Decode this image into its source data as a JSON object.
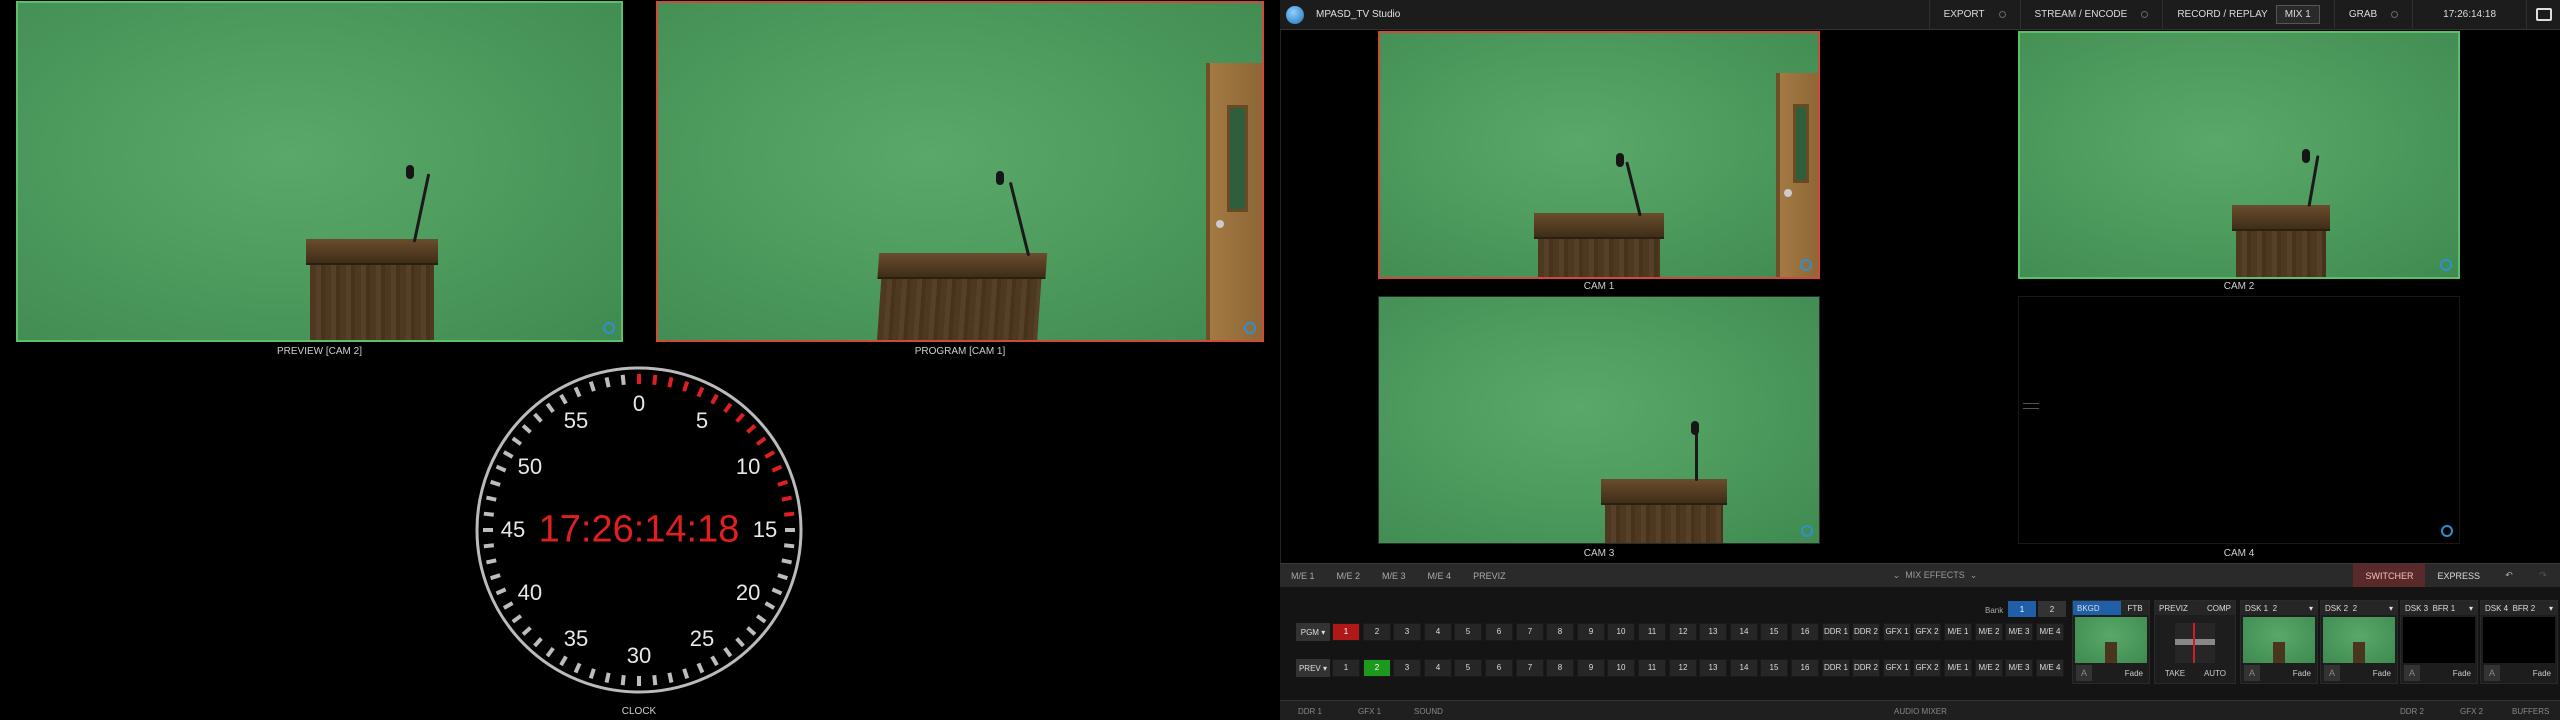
{
  "app": {
    "title": "MPASD_TV Studio",
    "topbar": {
      "export": "EXPORT",
      "stream": "STREAM / ENCODE",
      "record": "RECORD / REPLAY",
      "mix_select": "MIX 1",
      "grab": "GRAB",
      "time": "17:26:14:18"
    }
  },
  "multiview": {
    "preview_label": "PREVIEW [CAM 2]",
    "program_label": "PROGRAM [CAM 1]",
    "clock_label": "CLOCK",
    "clock_time": "17:26:14:18",
    "clock_numbers": [
      "0",
      "5",
      "10",
      "15",
      "20",
      "25",
      "30",
      "35",
      "40",
      "45",
      "50",
      "55"
    ]
  },
  "cameras": {
    "cam1": "CAM 1",
    "cam2": "CAM 2",
    "cam3": "CAM 3",
    "cam4": "CAM 4"
  },
  "switcher": {
    "tabs": [
      "M/E 1",
      "M/E 2",
      "M/E 3",
      "M/E 4",
      "PREVIZ"
    ],
    "mix_effects": "MIX EFFECTS",
    "switcher_tab": "SWITCHER",
    "express_tab": "EXPRESS",
    "bank_label": "Bank",
    "banks": [
      "1",
      "2"
    ],
    "pgm_label": "PGM",
    "prev_label": "PREV",
    "pgm_buttons": [
      "1",
      "2",
      "3",
      "4",
      "5",
      "6",
      "7",
      "8",
      "9",
      "10",
      "11",
      "12",
      "13",
      "14",
      "15",
      "16",
      "DDR 1",
      "DDR 2",
      "GFX 1",
      "GFX 2",
      "M/E 1",
      "M/E 2",
      "M/E 3",
      "M/E 4"
    ],
    "prev_buttons": [
      "1",
      "2",
      "3",
      "4",
      "5",
      "6",
      "7",
      "8",
      "9",
      "10",
      "11",
      "12",
      "13",
      "14",
      "15",
      "16",
      "DDR 1",
      "DDR 2",
      "GFX 1",
      "GFX 2",
      "M/E 1",
      "M/E 2",
      "M/E 3",
      "M/E 4"
    ],
    "pgm_active": "1",
    "prev_active": "2",
    "modules": {
      "bkgd": "BKGD",
      "ftb": "FTB",
      "previz": "PREVIZ",
      "comp": "COMP",
      "take": "TAKE",
      "auto": "AUTO",
      "dsk1": "DSK 1",
      "dsk1_src": "2",
      "dsk2": "DSK 2",
      "dsk2_src": "2",
      "dsk3": "DSK 3",
      "dsk3_src": "BFR 1",
      "dsk4": "DSK 4",
      "dsk4_src": "BFR 2",
      "fade": "Fade"
    }
  },
  "bottombar": {
    "ddr1": "DDR 1",
    "gfx1": "GFX 1",
    "sound": "SOUND",
    "audio_mixer": "AUDIO MIXER",
    "ddr2": "DDR 2",
    "gfx2": "GFX 2",
    "buffers": "BUFFERS"
  },
  "colors": {
    "preview_tally": "#5cc06a",
    "program_tally": "#d04a3a",
    "clock_red": "#e02020",
    "accent_blue": "#1f5fa8"
  }
}
